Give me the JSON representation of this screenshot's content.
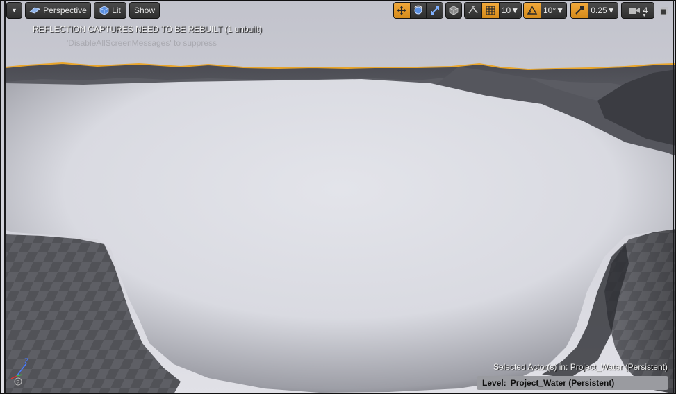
{
  "toolbar": {
    "menu_dropdown_icon": "chevron-down-icon",
    "perspective_label": "Perspective",
    "lit_label": "Lit",
    "show_label": "Show",
    "grid_snap_value": "10",
    "rotation_snap_value": "10°",
    "scale_snap_value": "0.25",
    "camera_speed_value": "4"
  },
  "messages": {
    "line1": "REFLECTION CAPTURES NEED TO BE REBUILT (1 unbuilt)",
    "line2": "'DisableAllScreenMessages' to suppress"
  },
  "status": {
    "selected_actor": "Selected Actor(s) in:  Project_Water (Persistent)",
    "level_label": "Level:",
    "level_value": "Project_Water (Persistent)"
  },
  "colors": {
    "accent": "#e8a030",
    "selection_outline": "#f0a623",
    "sky": "#cfd0d8",
    "water": "#d9dae2"
  }
}
